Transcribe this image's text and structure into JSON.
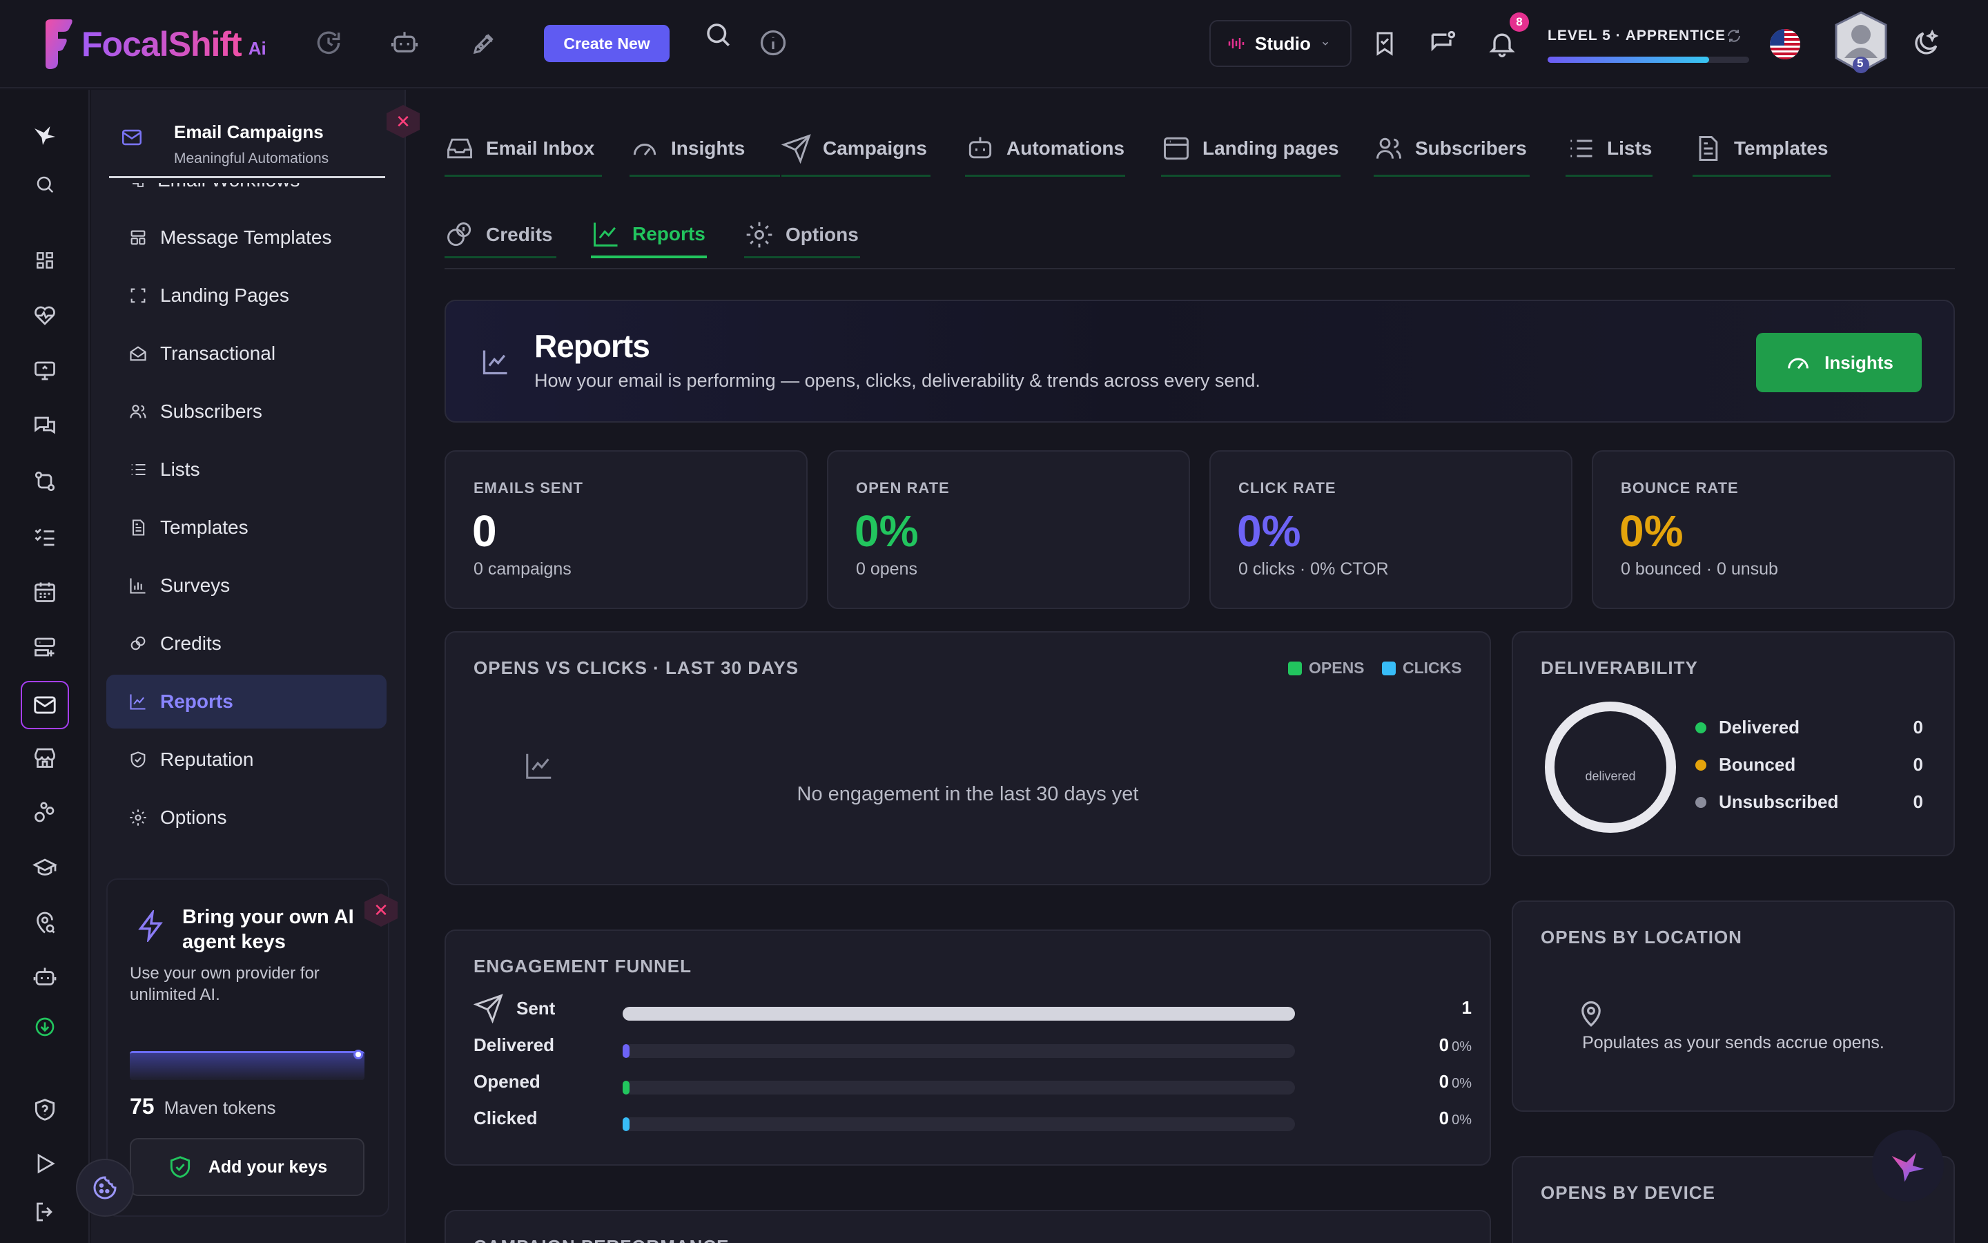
{
  "app": {
    "brand": "FocalShift",
    "brand_suffix": "Ai",
    "accent": "#5f5bf2"
  },
  "topbar": {
    "create_label": "Create New",
    "studio_label": "Studio",
    "notification_count": "8",
    "level_label": "LEVEL 5 · APPRENTICE",
    "level_progress": 0.8,
    "avatar_level": "5"
  },
  "sidebar": {
    "title": "Email Campaigns",
    "subtitle": "Meaningful Automations",
    "partial_item": "Email Workflows",
    "items": [
      {
        "label": "Message Templates",
        "icon": "layout-icon"
      },
      {
        "label": "Landing Pages",
        "icon": "frame-icon"
      },
      {
        "label": "Transactional",
        "icon": "envelope-open-icon"
      },
      {
        "label": "Subscribers",
        "icon": "users-icon"
      },
      {
        "label": "Lists",
        "icon": "list-icon"
      },
      {
        "label": "Templates",
        "icon": "document-icon"
      },
      {
        "label": "Surveys",
        "icon": "bar-chart-icon"
      },
      {
        "label": "Credits",
        "icon": "coins-icon"
      },
      {
        "label": "Reports",
        "icon": "line-chart-icon",
        "active": true
      },
      {
        "label": "Reputation",
        "icon": "shield-check-icon"
      },
      {
        "label": "Options",
        "icon": "gear-icon"
      }
    ]
  },
  "promo": {
    "title": "Bring your own AI agent keys",
    "subtitle": "Use your own provider for unlimited AI.",
    "tokens": "75",
    "tokens_label": "Maven tokens",
    "button": "Add your keys"
  },
  "tabs": [
    "Email Inbox",
    "Insights",
    "Campaigns",
    "Automations",
    "Landing pages",
    "Subscribers",
    "Lists",
    "Templates"
  ],
  "subtabs": [
    "Credits",
    "Reports",
    "Options"
  ],
  "banner": {
    "title": "Reports",
    "subtitle": "How your email is performing — opens, clicks, deliverability & trends across every send.",
    "button": "Insights"
  },
  "stats": [
    {
      "label": "EMAILS SENT",
      "value": "0",
      "sub": "0 campaigns",
      "color": "#ffffff"
    },
    {
      "label": "OPEN RATE",
      "value": "0%",
      "sub": "0 opens",
      "color": "#22c55e"
    },
    {
      "label": "CLICK RATE",
      "value": "0%",
      "sub": "0 clicks · 0% CTOR",
      "color": "#6d63f6"
    },
    {
      "label": "BOUNCE RATE",
      "value": "0%",
      "sub": "0 bounced · 0 unsub",
      "color": "#e4a40c"
    }
  ],
  "opens_clicks": {
    "title": "OPENS VS CLICKS · LAST 30 DAYS",
    "legend": [
      {
        "label": "OPENS",
        "color": "#22c55e"
      },
      {
        "label": "CLICKS",
        "color": "#38bdf8"
      }
    ],
    "empty": "No engagement in the last 30 days yet"
  },
  "deliverability": {
    "title": "DELIVERABILITY",
    "donut_label": "delivered",
    "rows": [
      {
        "label": "Delivered",
        "value": "0",
        "color": "#22c55e"
      },
      {
        "label": "Bounced",
        "value": "0",
        "color": "#e4a40c"
      },
      {
        "label": "Unsubscribed",
        "value": "0",
        "color": "#8b8d9c"
      }
    ]
  },
  "funnel": {
    "title": "ENGAGEMENT FUNNEL",
    "rows": [
      {
        "label": "Sent",
        "value": "1",
        "pct": "",
        "fill": 1.0,
        "color": "#d4d5de"
      },
      {
        "label": "Delivered",
        "value": "0",
        "pct": "0%",
        "fill": 0.0,
        "color": "#6d63f6"
      },
      {
        "label": "Opened",
        "value": "0",
        "pct": "0%",
        "fill": 0.0,
        "color": "#22c55e"
      },
      {
        "label": "Clicked",
        "value": "0",
        "pct": "0%",
        "fill": 0.0,
        "color": "#38bdf8"
      }
    ]
  },
  "location": {
    "title": "OPENS BY LOCATION",
    "empty": "Populates as your sends accrue opens."
  },
  "device": {
    "title": "OPENS BY DEVICE"
  },
  "campaign_perf": {
    "title": "CAMPAIGN PERFORMANCE"
  }
}
